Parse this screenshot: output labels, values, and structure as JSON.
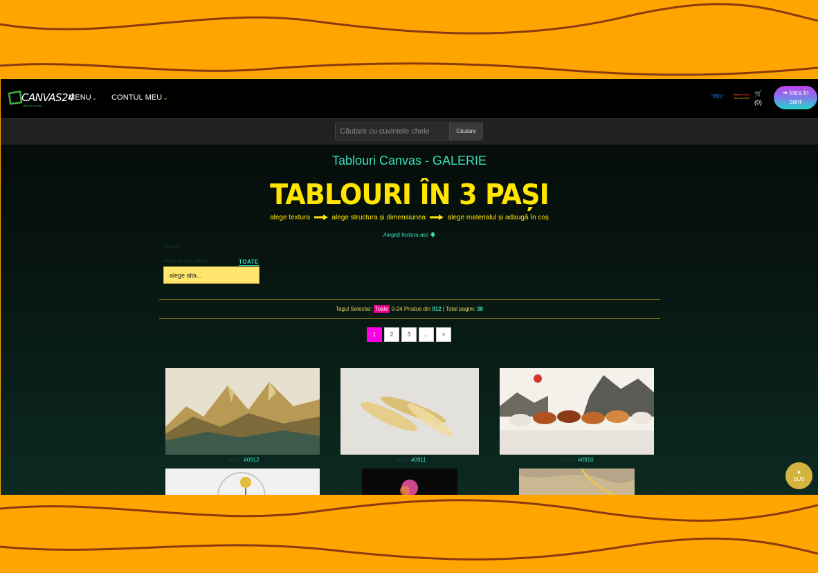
{
  "brand": {
    "logo_text": "CANVAS24",
    "logo_sub": "tablouri canvas"
  },
  "nav": {
    "menu_label": "MENU",
    "account_label": "CONTUL MEU",
    "pay_visa_top": "Verified by",
    "pay_visa_bottom": "VISA",
    "pay_mc_top": "MasterCard.",
    "pay_mc_bottom": "SecureCode",
    "cart_count": "(0)",
    "login_icon": "sign-in-icon",
    "login_line1": "Intra în",
    "login_line2": "cont"
  },
  "search": {
    "placeholder": "Căutare cu cuvintele cheie",
    "button_label": "Căutare"
  },
  "main": {
    "page_title": "Tablouri Canvas - GALERIE",
    "hero_title": "TABLOURI ÎN 3 PAȘI",
    "steps": [
      "alege textura",
      "alege structura și dimensiunea",
      "alege materialul și adaugă în coș"
    ],
    "choose_texture_link": "Alegeți textura aici",
    "faint_label": "Textură",
    "faint_label2": "Alege textura tablou",
    "tag_all": "TOATE",
    "select_value": "alege alta..."
  },
  "info": {
    "selected_tag_label": "Tagul Selectat:",
    "selected_tag": "Toate",
    "range": "0-24 Produs din",
    "total": "912",
    "pages_label": "| Total pagini:",
    "pages": "38"
  },
  "pagination": {
    "items": [
      "1",
      "2",
      "3",
      "...",
      ">"
    ],
    "active_page": "1"
  },
  "products": [
    {
      "prefix": "Tablou",
      "code": "#0912"
    },
    {
      "prefix": "Tablou",
      "code": "#0911"
    },
    {
      "prefix": "Tablou",
      "code": "#0910"
    }
  ],
  "back_to_top": {
    "icon": "arrow-up-icon",
    "label": "SUS"
  },
  "colors": {
    "accent_teal": "#3ce0bd",
    "accent_yellow": "#ffe500",
    "accent_magenta": "#ff00e6",
    "frame_bg": "#ffa500"
  }
}
